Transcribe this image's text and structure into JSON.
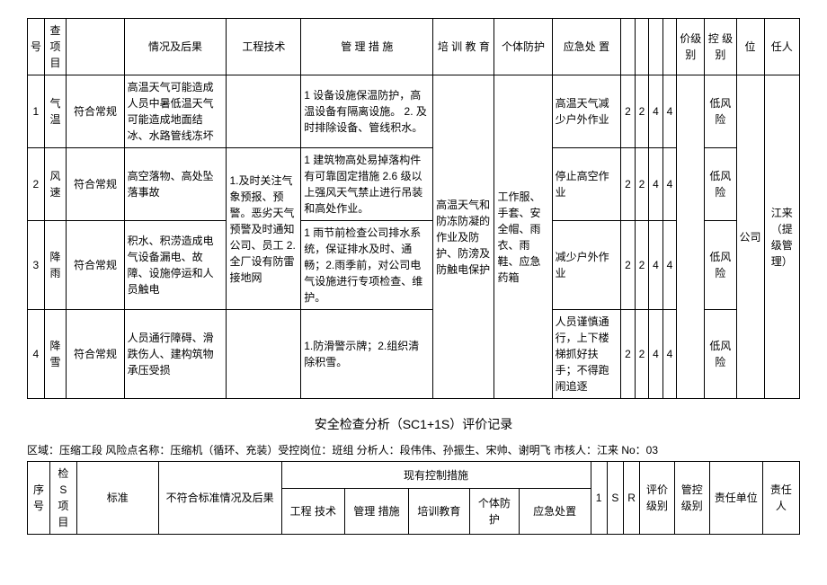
{
  "table1": {
    "headers": {
      "seq": "号",
      "check_item": "查\n项\n目",
      "situation": "情况及后果",
      "engineering": "工程技术",
      "management": "管\n理\n措\n施",
      "training": "培\n训\n教\n育",
      "protection": "个体防护",
      "emergency": "应急处\n置",
      "price_level": "价级\n别",
      "ctrl_level": "控\n级\n别",
      "unit": "位",
      "person": "任人"
    },
    "shared": {
      "standard": "符合常规",
      "training": "高温天气和防冻防凝的作业及防护、防滂及防触电保护",
      "protection": "工作服、手套、安全帽、雨衣、雨鞋、应急药箱",
      "unit": "公司",
      "person": "江来（提级管理）",
      "engineering_23": "1.及时关注气象预报、预警。恶劣天气预警及时通知公司、员工 2.全厂设有防雷接地网"
    },
    "rows": [
      {
        "seq": "1",
        "item": "气温",
        "situation": "高温天气可能造成人员中暑低温天气可能造成地面结冰、水路管线冻坏",
        "engineering": "",
        "management": "1 设备设施保温防护，高温设备有隔离设施。\n2. 及时排除设备、管线积水。",
        "emergency": "高温天气减少户外作业",
        "n1": "2",
        "n2": "2",
        "n3": "4",
        "n4": "4",
        "ctrl": "低风险"
      },
      {
        "seq": "2",
        "item": "风速",
        "situation": "高空落物、高处坠落事故",
        "management": "1 建筑物高处易掉落构件有可靠固定措施\n2.6 级以上强风天气禁止进行吊装和高处作业。",
        "emergency": "停止高空作业",
        "n1": "2",
        "n2": "2",
        "n3": "4",
        "n4": "4",
        "ctrl": "低风险"
      },
      {
        "seq": "3",
        "item": "降雨",
        "situation": "积水、积涝造成电气设备漏电、故障、设施停运和人员触电",
        "management": "1 雨节前检查公司排水系统，保证排水及时、通畅；2.雨季前，对公司电气设施进行专项检查、维护。",
        "emergency": "减少户外作业",
        "n1": "2",
        "n2": "2",
        "n3": "4",
        "n4": "4",
        "ctrl": "低风险"
      },
      {
        "seq": "4",
        "item": "降雪",
        "situation": "人员通行障碍、滑跌伤人、建构筑物承压受损",
        "engineering": "",
        "management": "1.防滑警示牌；2.组织清除积雪。",
        "emergency": "人员谨慎通行，上下楼梯抓好扶手；不得跑闹追逐",
        "n1": "2",
        "n2": "2",
        "n3": "4",
        "n4": "4",
        "ctrl": "低风险"
      }
    ]
  },
  "section2": {
    "title": "安全检查分析（SC1+1S）评价记录",
    "meta": "区域：压缩工段 风险点名称：压缩机（循环、充装）受控岗位：班组 分析人：段伟伟、孙振生、宋帅、谢明飞 市核人：江来 No：03",
    "headers": {
      "seq": "序\n号",
      "s_item": "检\nS\n项\n目",
      "standard": "标准",
      "situation": "不符合标准情况及后果",
      "current": "现有控制措施",
      "engineering": "工程\n技术",
      "management": "管理\n措施",
      "training": "培训教育",
      "protection": "个体防\n护",
      "emergency": "应急处置",
      "one": "1",
      "s": "S",
      "r": "R",
      "eval_level": "评价\n级别",
      "ctrl_level": "管控\n级别",
      "unit": "责任单位",
      "person": "责任\n人"
    }
  }
}
